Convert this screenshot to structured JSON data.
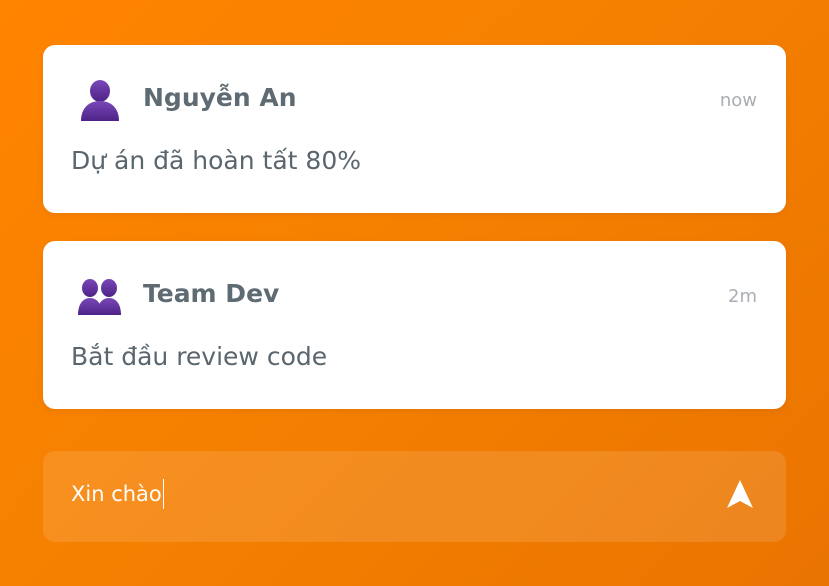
{
  "notifications": [
    {
      "icon": "user-icon",
      "sender": "Nguyễn An",
      "time": "now",
      "message": "Dự án đã hoàn tất 80%"
    },
    {
      "icon": "users-icon",
      "sender": "Team Dev",
      "time": "2m",
      "message": "Bắt đầu review code"
    }
  ],
  "composer": {
    "value": "Xin chào",
    "send_icon": "send-icon"
  },
  "colors": {
    "background": "#f58000",
    "card": "#ffffff",
    "sender_text": "#5f6b73",
    "time_text": "#a8aeb3",
    "avatar": "#5b2d91"
  }
}
